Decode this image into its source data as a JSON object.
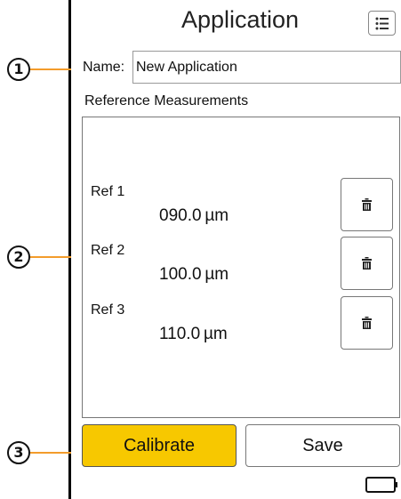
{
  "header": {
    "title": "Application",
    "menu_icon": "list-menu-icon"
  },
  "callouts": [
    "1",
    "2",
    "3"
  ],
  "name_field": {
    "label": "Name:",
    "value": "New Application"
  },
  "reference_section": {
    "label": "Reference Measurements"
  },
  "references": [
    {
      "label": "Ref 1",
      "value": "090.0 µm",
      "delete_icon": "trash-icon"
    },
    {
      "label": "Ref 2",
      "value": "100.0 µm",
      "delete_icon": "trash-icon"
    },
    {
      "label": "Ref 3",
      "value": "110.0 µm",
      "delete_icon": "trash-icon"
    }
  ],
  "actions": {
    "calibrate_label": "Calibrate",
    "save_label": "Save"
  },
  "status": {
    "battery_icon": "battery-icon"
  },
  "colors": {
    "calibrate_bg": "#f7c800",
    "callout_line": "#f39c2b"
  }
}
